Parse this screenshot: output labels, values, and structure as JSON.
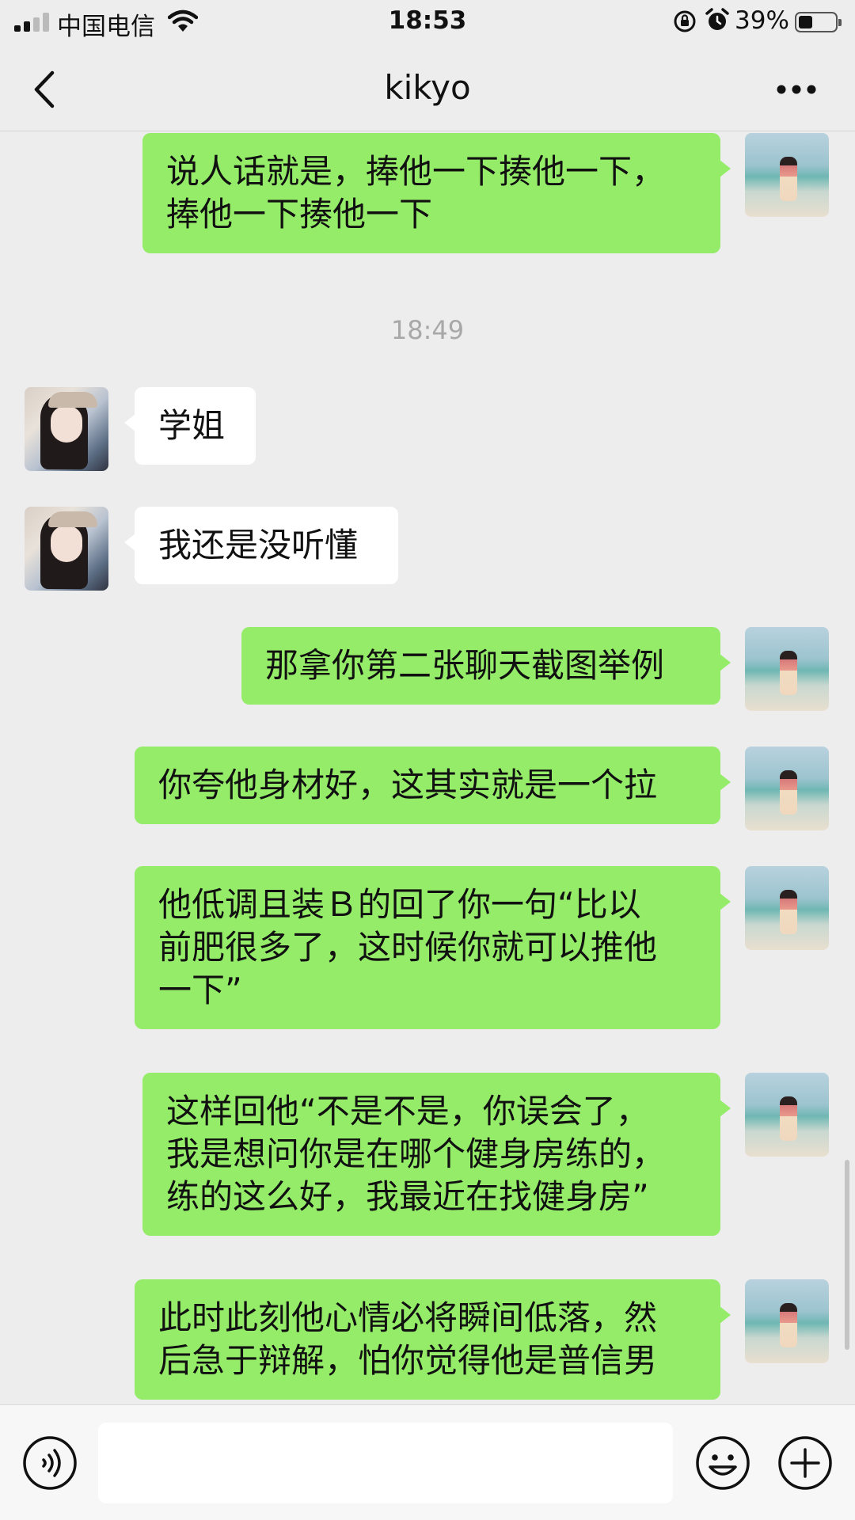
{
  "status_bar": {
    "carrier": "中国电信",
    "time": "18:53",
    "battery_pct": "39%",
    "icons": [
      "signal-icon",
      "wifi-icon",
      "orientation-lock-icon",
      "alarm-icon",
      "battery-icon"
    ]
  },
  "nav": {
    "title": "kikyo",
    "back_icon": "chevron-left-icon",
    "more_icon": "more-dots-icon"
  },
  "messages": [
    {
      "side": "mine",
      "lines": [
        "说人话就是，捧他一下揍他一下，",
        "捧他一下揍他一下"
      ]
    },
    {
      "type": "timestamp",
      "text": "18:49"
    },
    {
      "side": "theirs",
      "lines": [
        "学姐"
      ]
    },
    {
      "side": "theirs",
      "lines": [
        "我还是没听懂"
      ]
    },
    {
      "side": "mine",
      "lines": [
        "那拿你第二张聊天截图举例"
      ]
    },
    {
      "side": "mine",
      "lines": [
        "你夸他身材好，这其实就是一个拉"
      ]
    },
    {
      "side": "mine",
      "lines": [
        "他低调且装Ｂ的回了你一句“比以",
        "前肥很多了，这时候你就可以推他",
        "一下”"
      ]
    },
    {
      "side": "mine",
      "lines": [
        "这样回他“不是不是，你误会了，",
        "我是想问你是在哪个健身房练的，",
        "练的这么好，我最近在找健身房”"
      ]
    },
    {
      "side": "mine",
      "lines": [
        "此时此刻他心情必将瞬间低落，然",
        "后急于辩解，怕你觉得他是普信男"
      ]
    }
  ],
  "input_bar": {
    "placeholder": "",
    "icons": [
      "voice-icon",
      "emoji-icon",
      "plus-icon"
    ]
  },
  "colors": {
    "bubble_mine": "#95ec69",
    "bubble_theirs": "#ffffff",
    "background": "#ededed"
  }
}
